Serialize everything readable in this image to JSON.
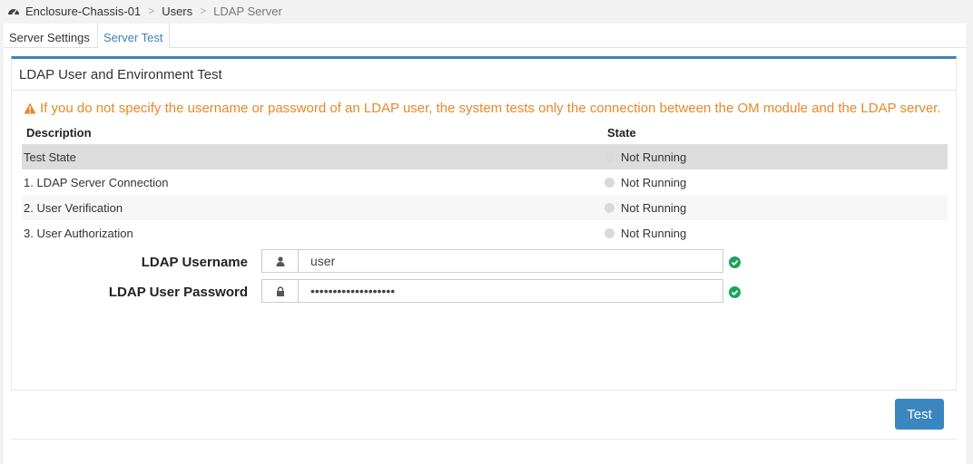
{
  "breadcrumb": {
    "icon": "dashboard-icon",
    "items": [
      "Enclosure-Chassis-01",
      "Users",
      "LDAP Server"
    ],
    "separator": ">"
  },
  "tabs": [
    {
      "label": "Server Settings",
      "active": false
    },
    {
      "label": "Server Test",
      "active": true
    }
  ],
  "card": {
    "title": "LDAP User and Environment Test",
    "warning": "If you do not specify the username or password of an LDAP user, the system tests only the connection between the OM module and the LDAP server."
  },
  "table": {
    "headers": [
      "Description",
      "State"
    ],
    "rows": [
      {
        "description": "Test State",
        "state": "Not Running"
      },
      {
        "description": "1. LDAP Server Connection",
        "state": "Not Running"
      },
      {
        "description": "2. User Verification",
        "state": "Not Running"
      },
      {
        "description": "3. User Authorization",
        "state": "Not Running"
      }
    ]
  },
  "form": {
    "username_label": "LDAP Username",
    "username_value": "user",
    "password_label": "LDAP User Password",
    "password_value": "•••••••••••••••••••"
  },
  "actions": {
    "test_label": "Test"
  },
  "colors": {
    "accent": "#3d84b5",
    "warning": "#e4892b",
    "valid": "#1aa35a",
    "status_idle": "#d9d9d9"
  }
}
